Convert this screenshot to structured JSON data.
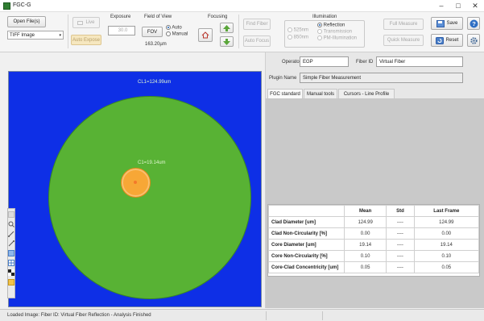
{
  "window": {
    "title": "FGC-G",
    "controls": [
      "–",
      "□",
      "✕"
    ]
  },
  "toolbar": {
    "open_files": "Open File(s)",
    "file_type": "TIFF Image",
    "live": "Live",
    "auto_expose": "Auto Expose",
    "exposure": {
      "label": "Exposure",
      "value": "30.0"
    },
    "fov": {
      "label": "Field of View",
      "button": "FOV",
      "auto": "Auto",
      "manual": "Manual",
      "value": "163.20µm"
    },
    "focusing": {
      "label": "Focusing"
    },
    "find_fiber": "Find Fiber",
    "auto_focus": "Auto Focus",
    "illumination": {
      "label": "Illumination",
      "wl1": "525nm",
      "wl2": "850nm",
      "reflection": "Reflection",
      "transmission": "Transmission",
      "pm": "PM-Illumination"
    },
    "full_measure": "Full Measure",
    "quick_measure": "Quick Measure",
    "save": "Save",
    "reset": "Reset"
  },
  "viewer": {
    "clad_label": "CL1=124.99um",
    "core_label": "C1=19.14um",
    "tool_icons": [
      "pan-tool-icon",
      "zoom-tool-icon",
      "measure-line-icon",
      "draw-line-icon",
      "zoom-fit-icon",
      "grid-icon",
      "checker-icon",
      "help-icon"
    ]
  },
  "form": {
    "operator_label": "Operator",
    "operator_value": "EGP",
    "fiber_id_label": "Fiber ID",
    "fiber_id_value": "Virtual Fiber",
    "plugin_label": "Plugin Name",
    "plugin_value": "Simple Fiber Measurement"
  },
  "tabs": [
    "FGC standard",
    "Manual tools",
    "Cursors - Line Profile"
  ],
  "results": {
    "headers": [
      "",
      "Mean",
      "Std",
      "Last Frame"
    ],
    "rows": [
      {
        "name": "Clad Diameter [um]",
        "mean": "124.99",
        "std": "----",
        "last": "124.99"
      },
      {
        "name": "Clad Non-Circularity [%]",
        "mean": "0.00",
        "std": "----",
        "last": "0.00"
      },
      {
        "name": "Core Diameter [um]",
        "mean": "19.14",
        "std": "----",
        "last": "19.14"
      },
      {
        "name": "Core Non-Circularity [%]",
        "mean": "0.10",
        "std": "----",
        "last": "0.10"
      },
      {
        "name": "Core-Clad Concentricity [um]",
        "mean": "0.05",
        "std": "----",
        "last": "0.05"
      }
    ]
  },
  "status": {
    "text": "Loaded Image: Fiber ID: Virtual Fiber Reflection - Analysis Finished"
  },
  "colors": {
    "viewer_bg": "#0e2fe6",
    "clad": "#58b234",
    "core": "#f7a736"
  }
}
